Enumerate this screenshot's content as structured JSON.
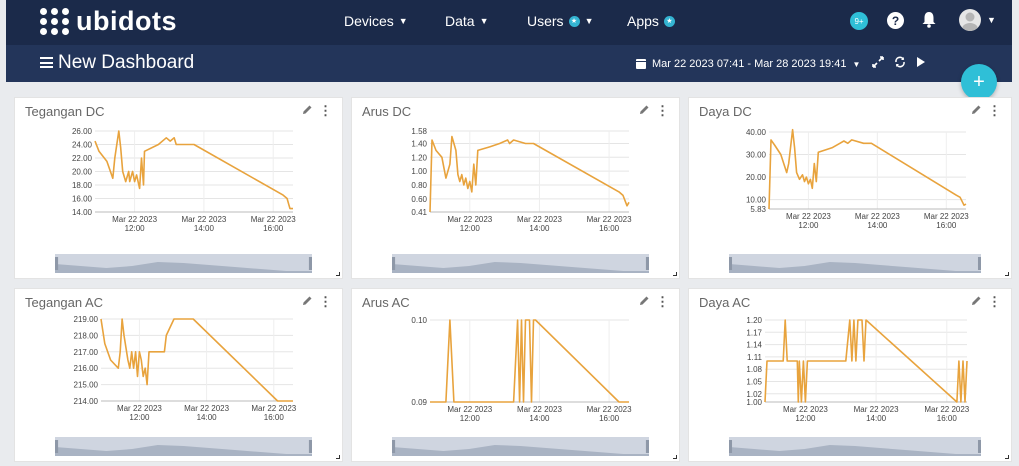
{
  "nav": {
    "logo_text": "ubidots",
    "menu": [
      {
        "label": "Devices",
        "has_caret": true,
        "has_star": false
      },
      {
        "label": "Data",
        "has_caret": true,
        "has_star": false
      },
      {
        "label": "Users",
        "has_caret": true,
        "has_star": true
      },
      {
        "label": "Apps",
        "has_caret": false,
        "has_star": true
      }
    ],
    "notifications_badge": "9+",
    "help_label": "?",
    "icons": {
      "bell": "bell-icon",
      "avatar": "avatar",
      "help": "help-icon"
    },
    "accent_color": "#2fbfd7"
  },
  "header": {
    "title": "New Dashboard",
    "date_range": "Mar 22 2023 07:41 - Mar 28 2023 19:41",
    "fab_label": "+"
  },
  "colors": {
    "line": "#e8a33d",
    "nav": "#1b2a4a",
    "subbar": "#23355a"
  },
  "widgets": [
    {
      "title": "Tegangan DC",
      "chart_data": {
        "type": "line",
        "ylim": [
          14.0,
          26.0
        ],
        "yticks": [
          "26.00",
          "24.00",
          "22.00",
          "20.00",
          "18.00",
          "16.00",
          "14.00"
        ],
        "xticks": [
          [
            "Mar 22 2023",
            "12:00"
          ],
          [
            "Mar 22 2023",
            "14:00"
          ],
          [
            "Mar 22 2023",
            "16:00"
          ]
        ],
        "series": [
          {
            "values": [
              [
                0.0,
                24.5
              ],
              [
                0.02,
                23.0
              ],
              [
                0.06,
                21.5
              ],
              [
                0.09,
                19.0
              ],
              [
                0.1,
                22.0
              ],
              [
                0.12,
                26.0
              ],
              [
                0.13,
                23.5
              ],
              [
                0.14,
                20.0
              ],
              [
                0.155,
                18.5
              ],
              [
                0.17,
                20.0
              ],
              [
                0.175,
                18.5
              ],
              [
                0.19,
                20.0
              ],
              [
                0.2,
                18.5
              ],
              [
                0.21,
                19.5
              ],
              [
                0.225,
                17.5
              ],
              [
                0.235,
                22.0
              ],
              [
                0.245,
                18.0
              ],
              [
                0.25,
                23.0
              ],
              [
                0.32,
                24.0
              ],
              [
                0.36,
                25.0
              ],
              [
                0.38,
                24.5
              ],
              [
                0.4,
                25.0
              ],
              [
                0.41,
                24.0
              ],
              [
                0.48,
                24.0
              ],
              [
                0.5,
                24.0
              ],
              [
                0.95,
                16.5
              ],
              [
                0.97,
                16.0
              ],
              [
                0.98,
                15.0
              ],
              [
                0.985,
                14.5
              ],
              [
                1.0,
                14.5
              ]
            ]
          }
        ]
      }
    },
    {
      "title": "Arus DC",
      "chart_data": {
        "type": "line",
        "ylim": [
          0.41,
          1.58
        ],
        "yticks": [
          "1.58",
          "1.40",
          "1.20",
          "1.00",
          "0.80",
          "0.60",
          "0.41"
        ],
        "xticks": [
          [
            "Mar 22 2023",
            "12:00"
          ],
          [
            "Mar 22 2023",
            "14:00"
          ],
          [
            "Mar 22 2023",
            "16:00"
          ]
        ],
        "series": [
          {
            "values": [
              [
                0.0,
                0.41
              ],
              [
                0.01,
                1.45
              ],
              [
                0.03,
                1.3
              ],
              [
                0.06,
                1.2
              ],
              [
                0.08,
                0.9
              ],
              [
                0.1,
                1.1
              ],
              [
                0.11,
                1.5
              ],
              [
                0.13,
                1.3
              ],
              [
                0.14,
                0.95
              ],
              [
                0.15,
                0.85
              ],
              [
                0.16,
                0.95
              ],
              [
                0.17,
                0.8
              ],
              [
                0.18,
                0.9
              ],
              [
                0.19,
                0.75
              ],
              [
                0.2,
                0.85
              ],
              [
                0.21,
                0.7
              ],
              [
                0.22,
                1.1
              ],
              [
                0.23,
                0.8
              ],
              [
                0.24,
                1.3
              ],
              [
                0.3,
                1.35
              ],
              [
                0.35,
                1.4
              ],
              [
                0.39,
                1.45
              ],
              [
                0.4,
                1.4
              ],
              [
                0.42,
                1.45
              ],
              [
                0.48,
                1.4
              ],
              [
                0.52,
                1.4
              ],
              [
                0.95,
                0.7
              ],
              [
                0.97,
                0.65
              ],
              [
                0.99,
                0.5
              ],
              [
                1.0,
                0.55
              ]
            ]
          }
        ]
      }
    },
    {
      "title": "Daya DC",
      "chart_data": {
        "type": "line",
        "ylim": [
          5.83,
          40.0
        ],
        "yticks": [
          "40.00",
          "30.00",
          "20.00",
          "10.00",
          "5.83"
        ],
        "xticks": [
          [
            "Mar 22 2023",
            "12:00"
          ],
          [
            "Mar 22 2023",
            "14:00"
          ],
          [
            "Mar 22 2023",
            "16:00"
          ]
        ],
        "series": [
          {
            "values": [
              [
                0.0,
                5.83
              ],
              [
                0.01,
                36.5
              ],
              [
                0.03,
                34.0
              ],
              [
                0.06,
                30.0
              ],
              [
                0.09,
                22.0
              ],
              [
                0.1,
                26.0
              ],
              [
                0.12,
                41.0
              ],
              [
                0.13,
                33.0
              ],
              [
                0.14,
                22.0
              ],
              [
                0.155,
                19.0
              ],
              [
                0.17,
                21.0
              ],
              [
                0.18,
                18.0
              ],
              [
                0.19,
                20.0
              ],
              [
                0.2,
                17.0
              ],
              [
                0.21,
                19.0
              ],
              [
                0.22,
                15.0
              ],
              [
                0.23,
                26.0
              ],
              [
                0.24,
                18.0
              ],
              [
                0.25,
                31.0
              ],
              [
                0.32,
                33.0
              ],
              [
                0.36,
                35.0
              ],
              [
                0.38,
                36.0
              ],
              [
                0.4,
                35.0
              ],
              [
                0.42,
                36.5
              ],
              [
                0.48,
                35.0
              ],
              [
                0.52,
                35.0
              ],
              [
                0.95,
                12.0
              ],
              [
                0.97,
                11.0
              ],
              [
                0.99,
                7.5
              ],
              [
                1.0,
                8.0
              ]
            ]
          }
        ]
      }
    },
    {
      "title": "Tegangan AC",
      "chart_data": {
        "type": "line",
        "ylim": [
          214.0,
          219.0
        ],
        "yticks": [
          "219.00",
          "218.00",
          "217.00",
          "216.00",
          "215.00",
          "214.00"
        ],
        "xticks": [
          [
            "Mar 22 2023",
            "12:00"
          ],
          [
            "Mar 22 2023",
            "14:00"
          ],
          [
            "Mar 22 2023",
            "16:00"
          ]
        ],
        "series": [
          {
            "values": [
              [
                0.0,
                219.0
              ],
              [
                0.02,
                217.5
              ],
              [
                0.05,
                216.5
              ],
              [
                0.09,
                216.0
              ],
              [
                0.1,
                217.0
              ],
              [
                0.11,
                219.0
              ],
              [
                0.12,
                218.0
              ],
              [
                0.14,
                216.5
              ],
              [
                0.15,
                216.0
              ],
              [
                0.16,
                217.0
              ],
              [
                0.17,
                216.0
              ],
              [
                0.18,
                217.0
              ],
              [
                0.19,
                215.5
              ],
              [
                0.2,
                217.0
              ],
              [
                0.21,
                216.5
              ],
              [
                0.22,
                215.5
              ],
              [
                0.23,
                216.0
              ],
              [
                0.24,
                215.0
              ],
              [
                0.25,
                217.0
              ],
              [
                0.33,
                217.0
              ],
              [
                0.34,
                218.0
              ],
              [
                0.38,
                219.0
              ],
              [
                0.48,
                219.0
              ],
              [
                0.92,
                214.0
              ],
              [
                1.0,
                214.0
              ]
            ]
          }
        ]
      }
    },
    {
      "title": "Arus AC",
      "chart_data": {
        "type": "line",
        "ylim": [
          0.09,
          0.1
        ],
        "yticks": [
          "0.10",
          "0.09"
        ],
        "xticks": [
          [
            "Mar 22 2023",
            "12:00"
          ],
          [
            "Mar 22 2023",
            "14:00"
          ],
          [
            "Mar 22 2023",
            "16:00"
          ]
        ],
        "series": [
          {
            "values": [
              [
                0.0,
                0.09
              ],
              [
                0.08,
                0.09
              ],
              [
                0.1,
                0.1
              ],
              [
                0.12,
                0.09
              ],
              [
                0.42,
                0.09
              ],
              [
                0.44,
                0.1
              ],
              [
                0.45,
                0.09
              ],
              [
                0.46,
                0.1
              ],
              [
                0.47,
                0.09
              ],
              [
                0.48,
                0.1
              ],
              [
                0.5,
                0.1
              ],
              [
                0.51,
                0.09
              ],
              [
                0.52,
                0.1
              ],
              [
                0.53,
                0.1
              ],
              [
                0.95,
                0.09
              ],
              [
                1.0,
                0.09
              ]
            ]
          }
        ]
      }
    },
    {
      "title": "Daya AC",
      "chart_data": {
        "type": "line",
        "ylim": [
          1.0,
          1.2
        ],
        "yticks": [
          "1.20",
          "1.17",
          "1.14",
          "1.11",
          "1.08",
          "1.05",
          "1.02",
          "1.00"
        ],
        "xticks": [
          [
            "Mar 22 2023",
            "12:00"
          ],
          [
            "Mar 22 2023",
            "14:00"
          ],
          [
            "Mar 22 2023",
            "16:00"
          ]
        ],
        "series": [
          {
            "values": [
              [
                0.0,
                1.0
              ],
              [
                0.01,
                1.1
              ],
              [
                0.09,
                1.1
              ],
              [
                0.1,
                1.2
              ],
              [
                0.11,
                1.1
              ],
              [
                0.16,
                1.1
              ],
              [
                0.165,
                1.0
              ],
              [
                0.17,
                1.1
              ],
              [
                0.18,
                1.0
              ],
              [
                0.19,
                1.1
              ],
              [
                0.2,
                1.0
              ],
              [
                0.21,
                1.1
              ],
              [
                0.4,
                1.1
              ],
              [
                0.42,
                1.2
              ],
              [
                0.43,
                1.1
              ],
              [
                0.44,
                1.2
              ],
              [
                0.45,
                1.1
              ],
              [
                0.46,
                1.2
              ],
              [
                0.48,
                1.2
              ],
              [
                0.49,
                1.1
              ],
              [
                0.5,
                1.2
              ],
              [
                0.95,
                1.0
              ],
              [
                0.96,
                1.1
              ],
              [
                0.97,
                1.0
              ],
              [
                0.98,
                1.1
              ],
              [
                0.99,
                1.0
              ],
              [
                1.0,
                1.1
              ]
            ]
          }
        ]
      }
    }
  ]
}
